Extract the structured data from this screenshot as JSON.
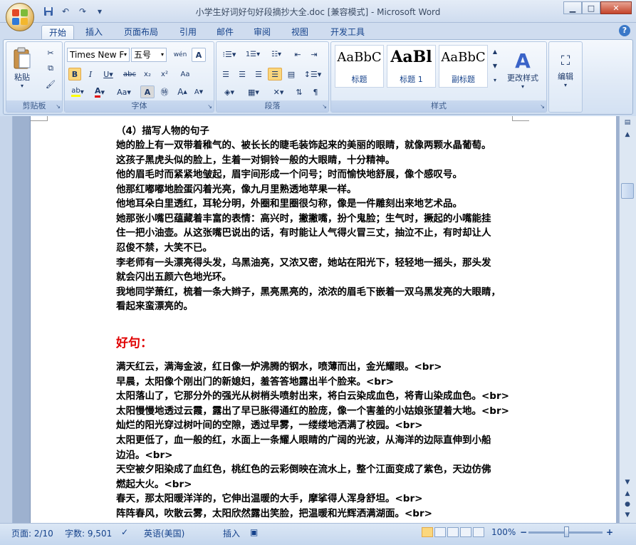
{
  "window": {
    "title": "小学生好词好句好段摘抄大全.doc [兼容模式] - Microsoft Word"
  },
  "quick_access": {
    "save_icon": "save-icon",
    "undo_icon": "undo-icon",
    "redo_icon": "redo-icon"
  },
  "tabs": [
    {
      "label": "开始",
      "active": true
    },
    {
      "label": "插入"
    },
    {
      "label": "页面布局"
    },
    {
      "label": "引用"
    },
    {
      "label": "邮件"
    },
    {
      "label": "审阅"
    },
    {
      "label": "视图"
    },
    {
      "label": "开发工具"
    }
  ],
  "ribbon": {
    "clipboard": {
      "paste_label": "粘贴",
      "group_label": "剪贴板"
    },
    "font": {
      "font_name": "Times New F",
      "font_size": "五号",
      "group_label": "字体"
    },
    "paragraph": {
      "group_label": "段落"
    },
    "styles": {
      "cards": [
        {
          "sample": "AaBbC",
          "name": "标题"
        },
        {
          "sample": "AaBl",
          "name": "标题 1"
        },
        {
          "sample": "AaBbC",
          "name": "副标题"
        }
      ],
      "change_styles_label": "更改样式",
      "group_label": "样式"
    },
    "editing": {
      "label": "编辑"
    }
  },
  "document": {
    "lines": [
      "（4）描写人物的句子",
      "她的脸上有一双带着稚气的、被长长的睫毛装饰起来的美丽的眼睛，就像两颗水晶葡萄。",
      "这孩子黑虎头似的脸上，生着一对铜铃一般的大眼睛，十分精神。",
      "他的眉毛时而紧紧地皱起，眉宇间形成一个问号；时而愉快地舒展，像个感叹号。",
      "他那红嘟嘟地脸蛋闪着光亮，像九月里熟透地苹果一样。",
      "他地耳朵白里透红，耳轮分明，外圈和里圈很匀称，像是一件雕刻出来地艺术品。",
      "她那张小嘴巴蕴藏着丰富的表情：高兴时，撇撇嘴，扮个鬼脸；生气时，撅起的小嘴能挂",
      "住一把小油壶。从这张嘴巴说出的话，有时能让人气得火冒三丈，抽泣不止，有时却让人",
      "忍俊不禁，大笑不已。",
      "李老师有一头漂亮得头发，乌黑油亮，又浓又密，她站在阳光下，轻轻地一摇头，那头发",
      "就会闪出五颜六色地光环。",
      "我地同学萧红，梳着一条大辫子，黑亮黑亮的，浓浓的眉毛下嵌着一双乌黑发亮的大眼睛，",
      "看起来蛮漂亮的。"
    ],
    "heading": "好句：",
    "sentences": [
      "满天红云，满海金波，红日像一炉沸腾的钢水，喷薄而出，金光耀眼。<br>",
      "早晨，太阳像个刚出门的新媳妇，羞答答地露出半个脸来。<br>",
      "太阳落山了，它那分外的强光从树梢头喷射出来，将白云染成血色，将青山染成血色。<br>",
      "太阳慢慢地透过云霞，露出了早已胀得通红的脸庞，像一个害羞的小姑娘张望着大地。<br>",
      "灿烂的阳光穿过树叶间的空隙，透过早雾，一缕缕地洒满了校园。<br>",
      "太阳更低了，血一般的红，水面上一条耀人眼睛的广阔的光波，从海洋的边际直伸到小船",
      "边沿。<br>",
      "天空被夕阳染成了血红色，桃红色的云彩倒映在流水上，整个江面变成了紫色，天边仿佛",
      "燃起大火。<br>",
      "春天，那太阳暖洋洋的，它伸出温暖的大手，摩挲得人浑身舒坦。<br>",
      "阵阵春风，吹散云雾，太阳欣然露出笑脸，把温暖和光辉洒满湖面。<br>"
    ]
  },
  "status": {
    "page": "页面: 2/10",
    "words": "字数: 9,501",
    "language": "英语(美国)",
    "mode": "插入",
    "zoom": "100%",
    "zoom_minus": "−",
    "zoom_plus": "+"
  }
}
